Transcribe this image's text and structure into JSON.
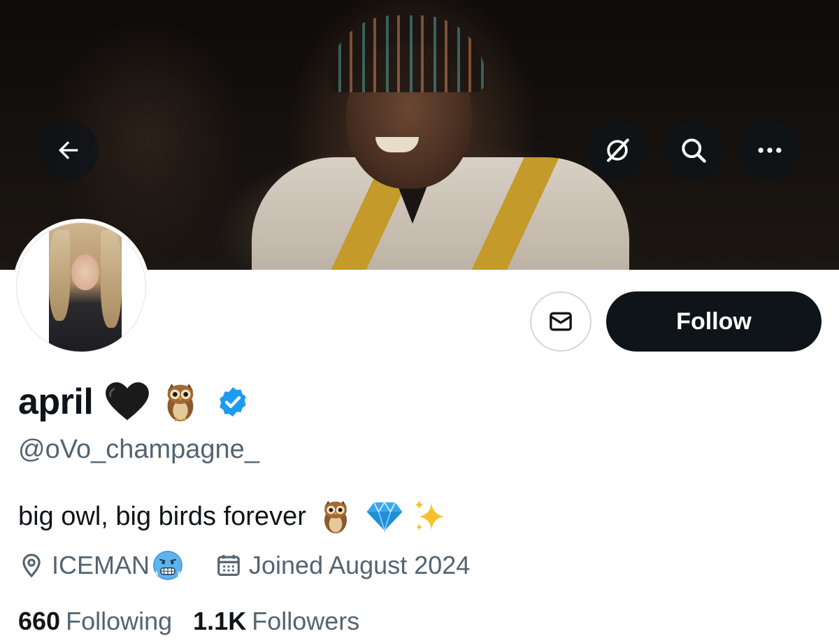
{
  "profile": {
    "display_name": "april",
    "name_emoji_1": "black-heart",
    "name_emoji_2": "owl",
    "verified": true,
    "handle": "@oVo_champagne_",
    "bio_text": "big owl, big birds forever",
    "bio_emojis": [
      "owl",
      "gem",
      "sparkles"
    ],
    "location": "ICEMAN",
    "location_emoji": "cold-face",
    "joined": "Joined August 2024"
  },
  "stats": {
    "following_count": "660",
    "following_label": "Following",
    "followers_count": "1.1K",
    "followers_label": "Followers"
  },
  "actions": {
    "follow_label": "Follow",
    "message_icon": "envelope-icon"
  },
  "header_buttons": {
    "back_icon": "arrow-left-icon",
    "grok_icon": "slashed-circle-icon",
    "search_icon": "search-icon",
    "more_icon": "more-icon"
  },
  "colors": {
    "follow_bg": "#0f1419",
    "verified_blue": "#1d9bf0",
    "secondary_text": "#536471"
  }
}
